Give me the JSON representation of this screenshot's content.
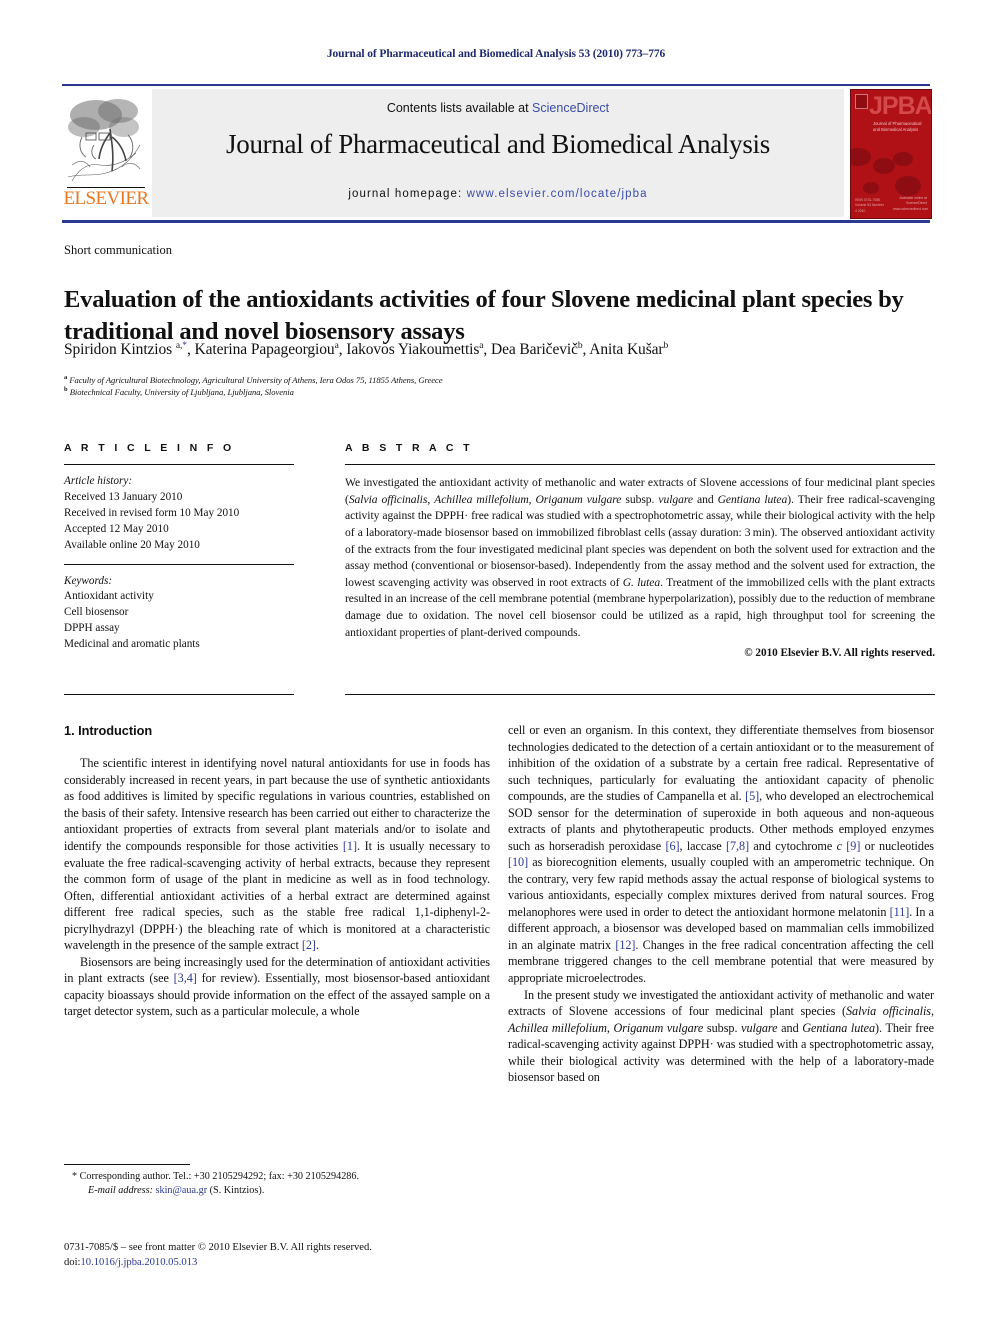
{
  "running_head": "Journal of Pharmaceutical and Biomedical Analysis 53 (2010) 773–776",
  "masthead": {
    "contents_prefix": "Contents lists available at ",
    "sciencedirect": "ScienceDirect",
    "journal_title": "Journal of Pharmaceutical and Biomedical Analysis",
    "homepage_prefix": "journal homepage: ",
    "homepage_url": "www.elsevier.com/locate/jpba",
    "publisher_wordmark": "ELSEVIER",
    "cover_wordmark": "JPBA",
    "cover_subtitle": "Journal of Pharmaceutical and Biomedical Analysis",
    "cover_footer_left": "ISSN 0731-7085\nVolume 53\nNumber 4\n2010",
    "cover_footer_right": "Available online at\nScienceDirect\nwww.sciencedirect.com",
    "link_color": "#3b4ca8",
    "rule_color": "#2b3990",
    "cover_color": "#b01116",
    "elsevier_orange": "#E87722"
  },
  "article": {
    "section_type": "Short communication",
    "title": "Evaluation of the antioxidants activities of four Slovene medicinal plant species by traditional and novel biosensory assays",
    "authors_html": "Spiridon Kintzios <sup>a,<span class=\"star\">*</span></sup>, Katerina Papageorgiou<sup>a</sup>, Iakovos Yiakoumettis<sup>a</sup>, Dea Baričevič<sup>b</sup>, Anita Kušar<sup>b</sup>",
    "affiliation_a": "Faculty of Agricultural Biotechnology, Agricultural University of Athens, Iera Odos 75, 11855 Athens, Greece",
    "affiliation_b": "Biotechnical Faculty, University of Ljubljana, Ljubljana, Slovenia"
  },
  "article_info": {
    "heading": "A R T I C L E   I N F O",
    "history_label": "Article history:",
    "history": [
      "Received 13 January 2010",
      "Received in revised form 10 May 2010",
      "Accepted 12 May 2010",
      "Available online 20 May 2010"
    ],
    "keywords_label": "Keywords:",
    "keywords": [
      "Antioxidant activity",
      "Cell biosensor",
      "DPPH assay",
      "Medicinal and aromatic plants"
    ]
  },
  "abstract": {
    "heading": "A B S T R A C T",
    "text_html": "We investigated the antioxidant activity of methanolic and water extracts of Slovene accessions of four medicinal plant species (<i>Salvia officinalis</i>, <i>Achillea millefolium</i>, <i>Origanum vulgare</i> subsp. <i>vulgare</i> and <i>Gentiana lutea</i>). Their free radical-scavenging activity against the DPPH&#183; free radical was studied with a spectrophotometric assay, while their biological activity with the help of a laboratory-made biosensor based on immobilized fibroblast cells (assay duration: 3&#8239;min). The observed antioxidant activity of the extracts from the four investigated medicinal plant species was dependent on both the solvent used for extraction and the assay method (conventional or biosensor-based). Independently from the assay method and the solvent used for extraction, the lowest scavenging activity was observed in root extracts of <i>G. lutea</i>. Treatment of the immobilized cells with the plant extracts resulted in an increase of the cell membrane potential (membrane hyperpolarization), possibly due to the reduction of membrane damage due to oxidation. The novel cell biosensor could be utilized as a rapid, high throughput tool for screening the antioxidant properties of plant-derived compounds.",
    "copyright": "© 2010 Elsevier B.V. All rights reserved."
  },
  "body": {
    "section_1_title": "1.  Introduction",
    "left_paragraphs_html": [
      "The scientific interest in identifying novel natural antioxidants for use in foods has considerably increased in recent years, in part because the use of synthetic antioxidants as food additives is limited by specific regulations in various countries, established on the basis of their safety. Intensive research has been carried out either to characterize the antioxidant properties of extracts from several plant materials and/or to isolate and identify the compounds responsible for those activities <span class=\"ref\">[1]</span>. It is usually necessary to evaluate the free radical-scavenging activity of herbal extracts, because they represent the common form of usage of the plant in medicine as well as in food technology. Often, differential antioxidant activities of a herbal extract are determined against different free radical species, such as the stable free radical 1,1-diphenyl-2-picrylhydrazyl (DPPH&#183;) the bleaching rate of which is monitored at a characteristic wavelength in the presence of the sample extract <span class=\"ref\">[2]</span>.",
      "Biosensors are being increasingly used for the determination of antioxidant activities in plant extracts (see <span class=\"ref\">[3,4]</span> for review). Essentially, most biosensor-based antioxidant capacity bioassays should provide information on the effect of the assayed sample on a target detector system, such as a particular molecule, a whole"
    ],
    "right_paragraphs_html": [
      "cell or even an organism. In this context, they differentiate themselves from biosensor technologies dedicated to the detection of a certain antioxidant or to the measurement of inhibition of the oxidation of a substrate by a certain free radical. Representative of such techniques, particularly for evaluating the antioxidant capacity of phenolic compounds, are the studies of Campanella et al. <span class=\"ref\">[5]</span>, who developed an electrochemical SOD sensor for the determination of superoxide in both aqueous and non-aqueous extracts of plants and phytotherapeutic products. Other methods employed enzymes such as horseradish peroxidase <span class=\"ref\">[6]</span>, laccase <span class=\"ref\">[7,8]</span> and cytochrome <i>c</i> <span class=\"ref\">[9]</span> or nucleotides <span class=\"ref\">[10]</span> as biorecognition elements, usually coupled with an amperometric technique. On the contrary, very few rapid methods assay the actual response of biological systems to various antioxidants, especially complex mixtures derived from natural sources. Frog melanophores were used in order to detect the antioxidant hormone melatonin <span class=\"ref\">[11]</span>. In a different approach, a biosensor was developed based on mammalian cells immobilized in an alginate matrix <span class=\"ref\">[12]</span>. Changes in the free radical concentration affecting the cell membrane triggered changes to the cell membrane potential that were measured by appropriate microelectrodes.",
      "In the present study we investigated the antioxidant activity of methanolic and water extracts of Slovene accessions of four medicinal plant species (<i>Salvia officinalis</i>, <i>Achillea millefolium</i>, <i>Origanum vulgare</i> subsp. <i>vulgare</i> and <i>Gentiana lutea</i>). Their free radical-scavenging activity against DPPH&#183; was studied with a spectrophotometric assay, while their biological activity was determined with the help of a laboratory-made biosensor based on"
    ]
  },
  "footnote": {
    "corresponding_html": "* Corresponding author. Tel.: +30 2105294292; fax: +30 2105294286.",
    "email_label": "E-mail address:",
    "email": "skin@aua.gr",
    "email_suffix": "(S. Kintzios).",
    "imprint": "0731-7085/$ – see front matter © 2010 Elsevier B.V. All rights reserved.",
    "doi_label": "doi:",
    "doi": "10.1016/j.jpba.2010.05.013"
  }
}
